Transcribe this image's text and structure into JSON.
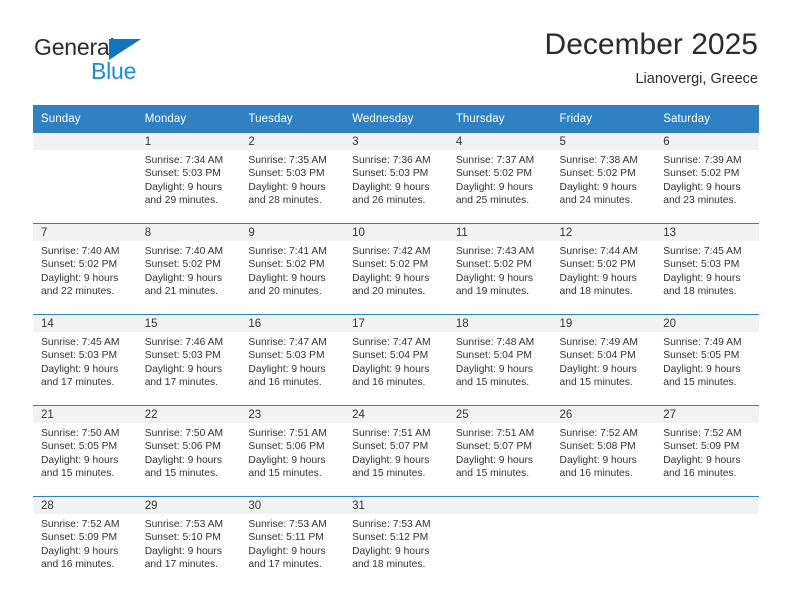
{
  "brand": {
    "name_top": "General",
    "name_bottom": "Blue",
    "triangle_color": "#1275c0",
    "blue_color": "#1a8ae5"
  },
  "header": {
    "title": "December 2025",
    "subtitle": "Lianovergi, Greece"
  },
  "theme": {
    "header_blue": "#3080c4",
    "daynum_band": "#f2f2f2",
    "text": "#333333"
  },
  "weekday_headers": [
    "Sunday",
    "Monday",
    "Tuesday",
    "Wednesday",
    "Thursday",
    "Friday",
    "Saturday"
  ],
  "weeks": [
    [
      {
        "day": "",
        "lines": []
      },
      {
        "day": "1",
        "lines": [
          "Sunrise: 7:34 AM",
          "Sunset: 5:03 PM",
          "Daylight: 9 hours",
          "and 29 minutes."
        ]
      },
      {
        "day": "2",
        "lines": [
          "Sunrise: 7:35 AM",
          "Sunset: 5:03 PM",
          "Daylight: 9 hours",
          "and 28 minutes."
        ]
      },
      {
        "day": "3",
        "lines": [
          "Sunrise: 7:36 AM",
          "Sunset: 5:03 PM",
          "Daylight: 9 hours",
          "and 26 minutes."
        ]
      },
      {
        "day": "4",
        "lines": [
          "Sunrise: 7:37 AM",
          "Sunset: 5:02 PM",
          "Daylight: 9 hours",
          "and 25 minutes."
        ]
      },
      {
        "day": "5",
        "lines": [
          "Sunrise: 7:38 AM",
          "Sunset: 5:02 PM",
          "Daylight: 9 hours",
          "and 24 minutes."
        ]
      },
      {
        "day": "6",
        "lines": [
          "Sunrise: 7:39 AM",
          "Sunset: 5:02 PM",
          "Daylight: 9 hours",
          "and 23 minutes."
        ]
      }
    ],
    [
      {
        "day": "7",
        "lines": [
          "Sunrise: 7:40 AM",
          "Sunset: 5:02 PM",
          "Daylight: 9 hours",
          "and 22 minutes."
        ]
      },
      {
        "day": "8",
        "lines": [
          "Sunrise: 7:40 AM",
          "Sunset: 5:02 PM",
          "Daylight: 9 hours",
          "and 21 minutes."
        ]
      },
      {
        "day": "9",
        "lines": [
          "Sunrise: 7:41 AM",
          "Sunset: 5:02 PM",
          "Daylight: 9 hours",
          "and 20 minutes."
        ]
      },
      {
        "day": "10",
        "lines": [
          "Sunrise: 7:42 AM",
          "Sunset: 5:02 PM",
          "Daylight: 9 hours",
          "and 20 minutes."
        ]
      },
      {
        "day": "11",
        "lines": [
          "Sunrise: 7:43 AM",
          "Sunset: 5:02 PM",
          "Daylight: 9 hours",
          "and 19 minutes."
        ]
      },
      {
        "day": "12",
        "lines": [
          "Sunrise: 7:44 AM",
          "Sunset: 5:02 PM",
          "Daylight: 9 hours",
          "and 18 minutes."
        ]
      },
      {
        "day": "13",
        "lines": [
          "Sunrise: 7:45 AM",
          "Sunset: 5:03 PM",
          "Daylight: 9 hours",
          "and 18 minutes."
        ]
      }
    ],
    [
      {
        "day": "14",
        "lines": [
          "Sunrise: 7:45 AM",
          "Sunset: 5:03 PM",
          "Daylight: 9 hours",
          "and 17 minutes."
        ]
      },
      {
        "day": "15",
        "lines": [
          "Sunrise: 7:46 AM",
          "Sunset: 5:03 PM",
          "Daylight: 9 hours",
          "and 17 minutes."
        ]
      },
      {
        "day": "16",
        "lines": [
          "Sunrise: 7:47 AM",
          "Sunset: 5:03 PM",
          "Daylight: 9 hours",
          "and 16 minutes."
        ]
      },
      {
        "day": "17",
        "lines": [
          "Sunrise: 7:47 AM",
          "Sunset: 5:04 PM",
          "Daylight: 9 hours",
          "and 16 minutes."
        ]
      },
      {
        "day": "18",
        "lines": [
          "Sunrise: 7:48 AM",
          "Sunset: 5:04 PM",
          "Daylight: 9 hours",
          "and 15 minutes."
        ]
      },
      {
        "day": "19",
        "lines": [
          "Sunrise: 7:49 AM",
          "Sunset: 5:04 PM",
          "Daylight: 9 hours",
          "and 15 minutes."
        ]
      },
      {
        "day": "20",
        "lines": [
          "Sunrise: 7:49 AM",
          "Sunset: 5:05 PM",
          "Daylight: 9 hours",
          "and 15 minutes."
        ]
      }
    ],
    [
      {
        "day": "21",
        "lines": [
          "Sunrise: 7:50 AM",
          "Sunset: 5:05 PM",
          "Daylight: 9 hours",
          "and 15 minutes."
        ]
      },
      {
        "day": "22",
        "lines": [
          "Sunrise: 7:50 AM",
          "Sunset: 5:06 PM",
          "Daylight: 9 hours",
          "and 15 minutes."
        ]
      },
      {
        "day": "23",
        "lines": [
          "Sunrise: 7:51 AM",
          "Sunset: 5:06 PM",
          "Daylight: 9 hours",
          "and 15 minutes."
        ]
      },
      {
        "day": "24",
        "lines": [
          "Sunrise: 7:51 AM",
          "Sunset: 5:07 PM",
          "Daylight: 9 hours",
          "and 15 minutes."
        ]
      },
      {
        "day": "25",
        "lines": [
          "Sunrise: 7:51 AM",
          "Sunset: 5:07 PM",
          "Daylight: 9 hours",
          "and 15 minutes."
        ]
      },
      {
        "day": "26",
        "lines": [
          "Sunrise: 7:52 AM",
          "Sunset: 5:08 PM",
          "Daylight: 9 hours",
          "and 16 minutes."
        ]
      },
      {
        "day": "27",
        "lines": [
          "Sunrise: 7:52 AM",
          "Sunset: 5:09 PM",
          "Daylight: 9 hours",
          "and 16 minutes."
        ]
      }
    ],
    [
      {
        "day": "28",
        "lines": [
          "Sunrise: 7:52 AM",
          "Sunset: 5:09 PM",
          "Daylight: 9 hours",
          "and 16 minutes."
        ]
      },
      {
        "day": "29",
        "lines": [
          "Sunrise: 7:53 AM",
          "Sunset: 5:10 PM",
          "Daylight: 9 hours",
          "and 17 minutes."
        ]
      },
      {
        "day": "30",
        "lines": [
          "Sunrise: 7:53 AM",
          "Sunset: 5:11 PM",
          "Daylight: 9 hours",
          "and 17 minutes."
        ]
      },
      {
        "day": "31",
        "lines": [
          "Sunrise: 7:53 AM",
          "Sunset: 5:12 PM",
          "Daylight: 9 hours",
          "and 18 minutes."
        ]
      },
      {
        "day": "",
        "lines": []
      },
      {
        "day": "",
        "lines": []
      },
      {
        "day": "",
        "lines": []
      }
    ]
  ]
}
